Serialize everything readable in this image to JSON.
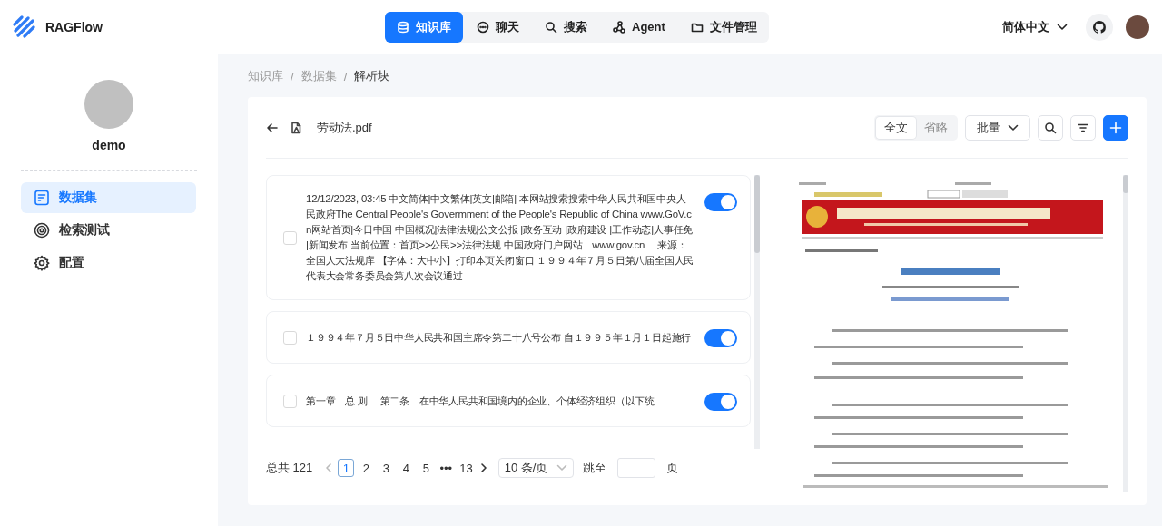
{
  "logo": {
    "text": "RAGFlow"
  },
  "nav": [
    {
      "label": "知识库",
      "kind": "database",
      "selected": true
    },
    {
      "label": "聊天",
      "kind": "chat",
      "selected": false
    },
    {
      "label": "搜索",
      "kind": "search",
      "selected": false
    },
    {
      "label": "Agent",
      "kind": "agent",
      "selected": false
    },
    {
      "label": "文件管理",
      "kind": "folder",
      "selected": false
    }
  ],
  "language": "简体中文",
  "sidebar": {
    "user_name": "demo",
    "items": [
      {
        "label": "数据集",
        "kind": "dataset",
        "selected": true
      },
      {
        "label": "检索测试",
        "kind": "target",
        "selected": false
      },
      {
        "label": "配置",
        "kind": "gear",
        "selected": false
      }
    ]
  },
  "breadcrumb": [
    {
      "label": "知识库",
      "kind": "link"
    },
    {
      "label": "/",
      "kind": "separator"
    },
    {
      "label": "数据集",
      "kind": "link"
    },
    {
      "label": "/",
      "kind": "separator"
    },
    {
      "label": "解析块",
      "kind": "current"
    }
  ],
  "document": {
    "file_name": "劳动法.pdf"
  },
  "view_modes": [
    {
      "label": "全文",
      "selected": true
    },
    {
      "label": "省略",
      "selected": false
    }
  ],
  "bulk_button": "批量",
  "chunks": [
    {
      "text": "12/12/2023, 03:45 中文简体|中文繁体|英文|邮箱| 本网站搜索搜索中华人民共和国中央人民政府The Central People's Govermment of the People's Republic of China www.GoV.cn网站首页|今日中国 中国概况|法律法规|公文公报 |政务互动 |政府建设 |工作动态|人事任免 |新闻发布 当前位置：首页>>公民>>法律法规 中国政府门户网站　www.gov.cn　 来源：全国人大法规库 【字体：大中小】打印本页关闭窗口 １９９４年７月５日第八届全国人民代表大会常务委员会第八次会议通过",
      "checked": false,
      "enabled": true
    },
    {
      "text": "１９９４年７月５日中华人民共和国主席令第二十八号公布 自１９９５年１月１日起施行",
      "checked": false,
      "enabled": true
    },
    {
      "text": "第一章　总 则　 第二条　在中华人民共和国境内的企业、个体经济组织（以下统",
      "checked": false,
      "enabled": true
    }
  ],
  "pagination": {
    "total": "总共 121",
    "pages": [
      {
        "label": "1",
        "selected": true
      },
      {
        "label": "2",
        "selected": false
      },
      {
        "label": "3",
        "selected": false
      },
      {
        "label": "4",
        "selected": false
      },
      {
        "label": "5",
        "selected": false
      },
      {
        "label": "•••",
        "selected": false
      },
      {
        "label": "13",
        "selected": false
      }
    ],
    "page_size": "10 条/页",
    "jump_label": "跳至",
    "page_unit": "页"
  }
}
